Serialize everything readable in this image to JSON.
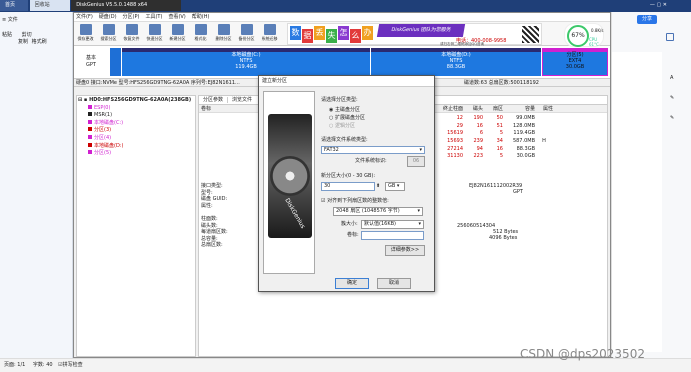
{
  "taskbar": {
    "home_tab": "首页",
    "doc_tab": "回收站",
    "app_title": "DiskGenius V5.5.0.1488 x64",
    "share": "分享"
  },
  "left_panel": {
    "file": "文件",
    "paste": "粘贴",
    "cut": "剪切",
    "copy": "复制",
    "format": "格式刷",
    "page_count": "页面: 1/1",
    "word_count": "字数: 40",
    "spell": "拼写检查"
  },
  "dg_menu": [
    "文件(F)",
    "硬盘(D)",
    "分区(P)",
    "工具(T)",
    "查看(V)",
    "帮助(H)"
  ],
  "toolbar": [
    "保存更改",
    "搜索分区",
    "恢复文件",
    "快速分区",
    "新建分区",
    "格式化",
    "删除分区",
    "备份分区",
    "系统迁移"
  ],
  "banner": {
    "chars": [
      "数",
      "据",
      "丢",
      "失",
      "怎",
      "么",
      "办"
    ],
    "badge": "DiskGenius 团队为您服务",
    "phone": "电话：400-008-9958",
    "qq": "或扫右侧二维码添加QQ咨询"
  },
  "disk_map": {
    "label1": "基本",
    "label2": "GPT",
    "partitions": [
      {
        "name": "本地磁盘(C:)",
        "fs": "NTFS",
        "size": "119.4GB",
        "color": "#1e6fd6"
      },
      {
        "name": "本地磁盘(D:)",
        "fs": "NTFS",
        "size": "88.3GB",
        "color": "#1e6fd6"
      },
      {
        "name": "分区(5)",
        "fs": "EXT4",
        "size": "30.0GB",
        "color": "#1e6fd6"
      }
    ]
  },
  "info_line": {
    "left": "硬盘0 接口:NVMe 型号:HFS256GD9TNG-62A0A 序列号:EJ82N1611...",
    "right": "磁道数:63 总扇区数:500118192"
  },
  "tree": {
    "disk": "HD0:HFS256GD9TNG-62A0A(238GB)",
    "items": [
      "ESP(0)",
      "MSR(1)",
      "本地磁盘(C:)",
      "分区(3)",
      "分区(4)",
      "本地磁盘(D:)",
      "分区(5)"
    ]
  },
  "tabs": [
    "分区参数",
    "浏览文件",
    "扇区编辑"
  ],
  "columns": [
    "终止柱面",
    "磁头",
    "扇区",
    "容量",
    "属性"
  ],
  "rows": [
    {
      "cyl": "12",
      "head": "190",
      "sec": "50",
      "cap": "99.0MB",
      "attr": ""
    },
    {
      "cyl": "29",
      "head": "16",
      "sec": "51",
      "cap": "128.0MB",
      "attr": ""
    },
    {
      "cyl": "15619",
      "head": "6",
      "sec": "5",
      "cap": "119.4GB",
      "attr": ""
    },
    {
      "cyl": "15693",
      "head": "239",
      "sec": "34",
      "cap": "587.0MB",
      "attr": "H"
    },
    {
      "cyl": "27214",
      "head": "94",
      "sec": "16",
      "cap": "88.3GB",
      "attr": ""
    },
    {
      "cyl": "31130",
      "head": "223",
      "sec": "5",
      "cap": "30.0GB",
      "attr": ""
    }
  ],
  "detail": {
    "labels": [
      "接口类型:",
      "型号:",
      "磁盘 GUID:",
      "属性:",
      "",
      "柱面数:",
      "磁头数:",
      "每道扇区数:",
      "总容量:",
      "总扇区数:"
    ],
    "serial": "EJ82N161112002R39",
    "style": "GPT",
    "sectors": "256060514304",
    "bytes1": "512 Bytes",
    "bytes2": "4096 Bytes"
  },
  "dialog": {
    "title": "建立新分区",
    "type_label": "请选择分区类型:",
    "r1": "主磁盘分区",
    "r2": "扩展磁盘分区",
    "r3": "逻辑分区",
    "fs_label": "请选择文件系统类型:",
    "fs_value": "FAT32",
    "fs_id_label": "文件系统标识:",
    "fs_id_btn": "06",
    "size_label": "新分区大小(0 - 30 GB):",
    "size_value": "30",
    "unit": "GB",
    "align_label": "对齐到下列扇区数的整数倍:",
    "align_value": "2048 扇区 (1048576 字节)",
    "cluster_label": "簇大小:",
    "cluster_value": "默认值(16KB)",
    "vol_label": "卷标:",
    "adv": "详细参数>>",
    "ok": "确定",
    "cancel": "取消",
    "art": "DiskGenius"
  },
  "right_panel": {
    "speed": "0.8K/s",
    "percent": "67%",
    "cpu": "CPU 61°C"
  },
  "watermark": "CSDN @dps2023502",
  "colors": {
    "accent": "#1e6fd6",
    "red": "#cc0000",
    "magenta": "#d020d0"
  }
}
